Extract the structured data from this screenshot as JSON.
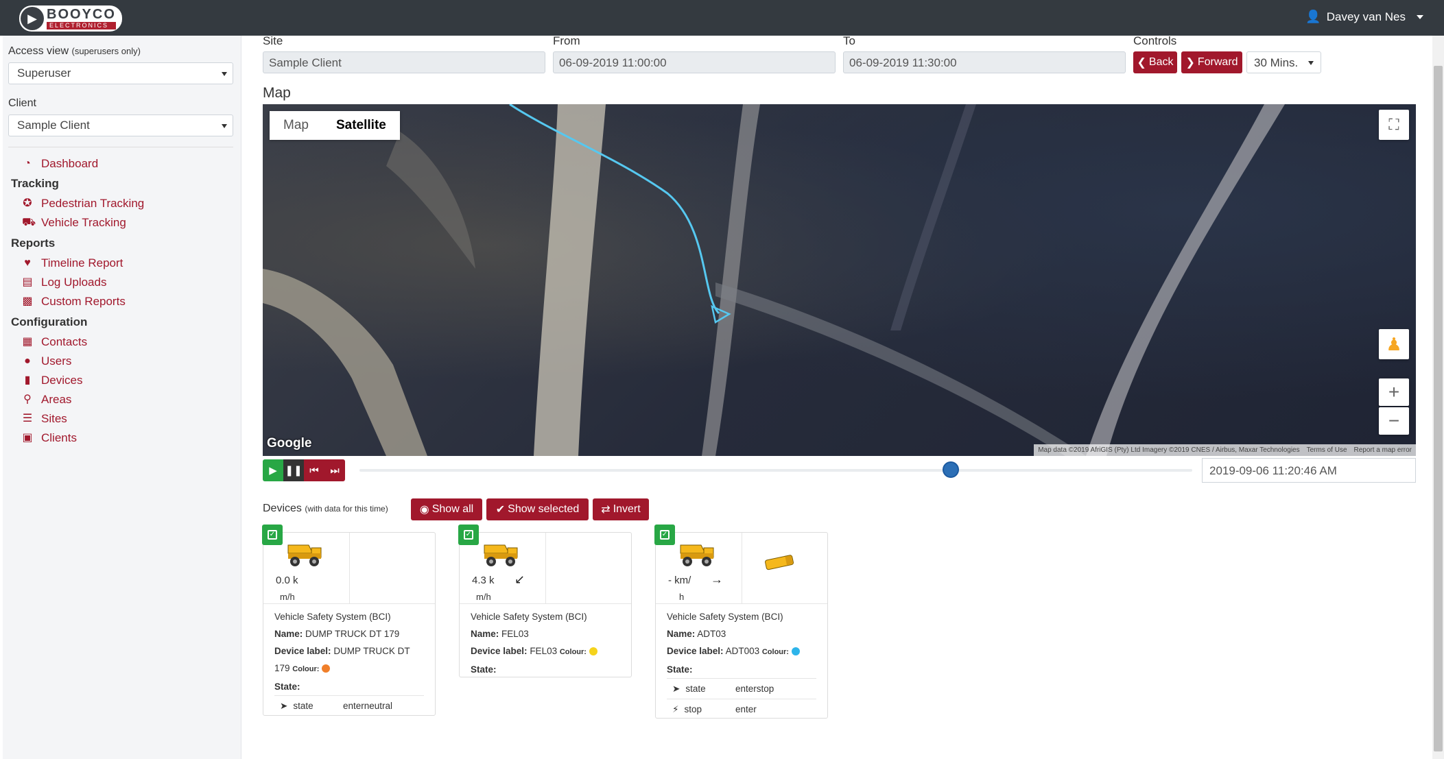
{
  "header": {
    "logo_main": "BOOYCO",
    "logo_sub": "ELECTRONICS",
    "user_name": "Davey van Nes"
  },
  "sidebar": {
    "access_view_label": "Access view",
    "access_view_note": "(superusers only)",
    "access_view_value": "Superuser",
    "client_label": "Client",
    "client_value": "Sample Client",
    "dashboard": "Dashboard",
    "tracking_head": "Tracking",
    "pedestrian_tracking": "Pedestrian Tracking",
    "vehicle_tracking": "Vehicle Tracking",
    "reports_head": "Reports",
    "timeline_report": "Timeline Report",
    "log_uploads": "Log Uploads",
    "custom_reports": "Custom Reports",
    "configuration_head": "Configuration",
    "contacts": "Contacts",
    "users": "Users",
    "devices": "Devices",
    "areas": "Areas",
    "sites": "Sites",
    "clients": "Clients"
  },
  "filters": {
    "site_label": "Site",
    "site_value": "Sample Client",
    "from_label": "From",
    "from_value": "06-09-2019 11:00:00",
    "to_label": "To",
    "to_value": "06-09-2019 11:30:00",
    "controls_label": "Controls",
    "back_label": "Back",
    "forward_label": "Forward",
    "interval_value": "30 Mins."
  },
  "map": {
    "title": "Map",
    "type_map": "Map",
    "type_satellite": "Satellite",
    "google": "Google",
    "attribution": "Map data ©2019 AfriGIS (Pty) Ltd Imagery ©2019 CNES / Airbus, Maxar Technologies",
    "terms": "Terms of Use",
    "report_error": "Report a map error"
  },
  "playback": {
    "progress_fraction": 0.71,
    "timestamp": "2019-09-06 11:20:46 AM"
  },
  "devices": {
    "label": "Devices",
    "note": "(with data for this time)",
    "show_all": "Show all",
    "show_selected": "Show selected",
    "invert": "Invert",
    "cards": [
      {
        "speed": "0.0 k",
        "speed_unit": "m/h",
        "system": "Vehicle Safety System (BCI)",
        "name_key": "Name:",
        "name": "DUMP TRUCK DT 179",
        "label_key": "Device label:",
        "label": "DUMP TRUCK DT 179",
        "colour_key": "Colour:",
        "colour": "#f07f2a",
        "state_key": "State:",
        "states": [
          {
            "k": "state",
            "v": "enterneutral"
          }
        ]
      },
      {
        "speed": "4.3 k",
        "speed_unit": "m/h",
        "system": "Vehicle Safety System (BCI)",
        "name_key": "Name:",
        "name": "FEL03",
        "label_key": "Device label:",
        "label": "FEL03",
        "colour_key": "Colour:",
        "colour": "#f5d31c",
        "state_key": "State:"
      },
      {
        "speed": "- km/",
        "speed_unit": "h",
        "system": "Vehicle Safety System (BCI)",
        "name_key": "Name:",
        "name": "ADT03",
        "label_key": "Device label:",
        "label": "ADT003",
        "colour_key": "Colour:",
        "colour": "#2db4ea",
        "state_key": "State:",
        "states": [
          {
            "k": "state",
            "v": "enterstop"
          },
          {
            "k": "stop",
            "v": "enter"
          }
        ]
      }
    ]
  }
}
